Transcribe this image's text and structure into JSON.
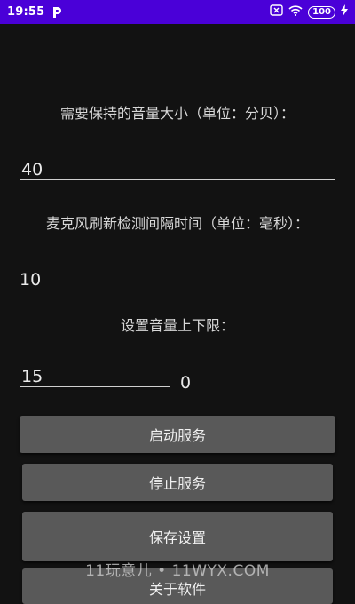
{
  "status": {
    "time": "19:55",
    "battery": "100"
  },
  "form": {
    "volume_label": "需要保持的音量大小（单位：分贝）：",
    "volume_value": "40",
    "interval_label": "麦克风刷新检测间隔时间（单位：毫秒）：",
    "interval_value": "10",
    "range_label": "设置音量上下限：",
    "range_low": "15",
    "range_high": "0"
  },
  "buttons": {
    "start": "启动服务",
    "stop": "停止服务",
    "save": "保存设置",
    "about": "关于软件"
  },
  "watermark": "11玩意儿 • 11WYX.COM",
  "colors": {
    "status_bar": "#4a00d8",
    "background": "#121212",
    "button": "#595959"
  }
}
